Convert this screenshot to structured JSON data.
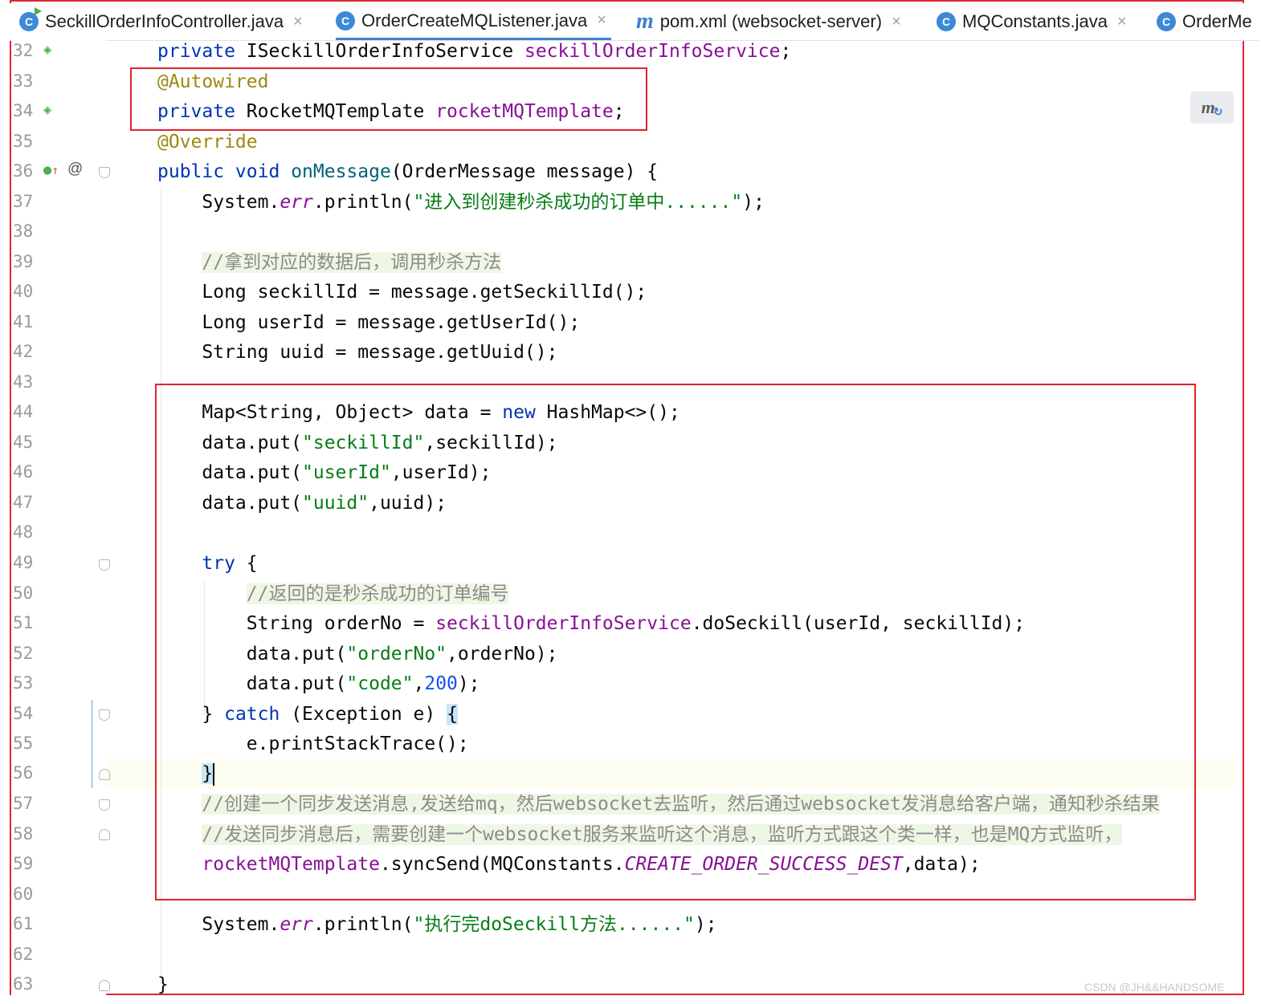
{
  "tabs": [
    {
      "label": "SeckillOrderInfoController.java",
      "icon": "class-icon",
      "close": "×",
      "active": false
    },
    {
      "label": "OrderCreateMQListener.java",
      "icon": "class-icon",
      "close": "×",
      "active": true
    },
    {
      "label": "pom.xml (websocket-server)",
      "icon": "maven-icon",
      "close": "×",
      "active": false
    },
    {
      "label": "MQConstants.java",
      "icon": "class-icon",
      "close": "×",
      "active": false
    },
    {
      "label": "OrderMe",
      "icon": "class-icon",
      "close": "",
      "active": false
    }
  ],
  "gutter": {
    "line_numbers": [
      "32",
      "33",
      "34",
      "35",
      "36",
      "37",
      "38",
      "39",
      "40",
      "41",
      "42",
      "43",
      "44",
      "45",
      "46",
      "47",
      "48",
      "49",
      "50",
      "51",
      "52",
      "53",
      "54",
      "55",
      "56",
      "57",
      "58",
      "59",
      "60",
      "61",
      "62",
      "63"
    ],
    "bean_icon": "spring-bean-icon",
    "override_icon": "implements-method-icon",
    "at_symbol": "@"
  },
  "editor": {
    "maven_button": "m",
    "current_line": "56"
  },
  "watermark": "CSDN @JH&&HANDSOME",
  "colors": {
    "keyword": "#0033b3",
    "field": "#871094",
    "string": "#067d17",
    "annotation": "#9e880d",
    "comment": "#8c8c8c",
    "number": "#1750eb",
    "highlight_box": "#e0242c"
  }
}
